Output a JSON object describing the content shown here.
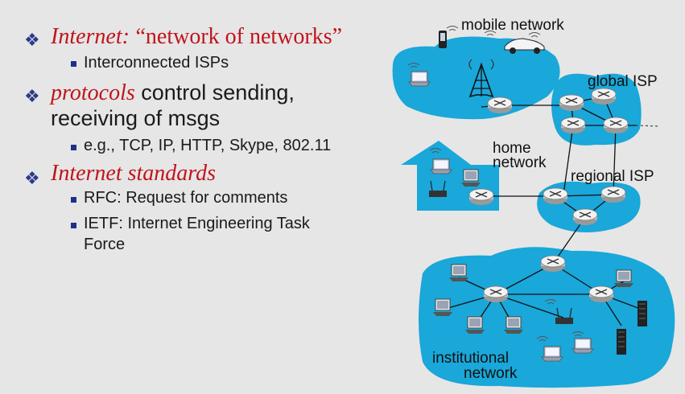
{
  "bullets": {
    "b1": {
      "italic": "Internet:",
      "quote": "“network of networks”"
    },
    "b1_sub1": "Interconnected ISPs",
    "b2": {
      "italic": "protocols",
      "rest": " control sending,",
      "line2": "receiving of msgs"
    },
    "b2_sub1": "e.g., TCP, IP, HTTP, Skype,  802.11",
    "b3": {
      "italic": "Internet  standards"
    },
    "b3_sub1": "RFC: Request for comments",
    "b3_sub2_line1": "IETF: Internet Engineering Task",
    "b3_sub2_line2": "Force"
  },
  "diagram": {
    "labels": {
      "mobile": "mobile network",
      "global": "global ISP",
      "home_line1": "home",
      "home_line2": "network",
      "regional": "regional ISP",
      "inst_line1": "institutional",
      "inst_line2": "network"
    },
    "colors": {
      "cloud": "#1aa7d9",
      "router": "#e8e8e8"
    }
  },
  "icons": {
    "bullet": "diamond-bullet-icon",
    "sub_bullet": "square-bullet-icon"
  }
}
